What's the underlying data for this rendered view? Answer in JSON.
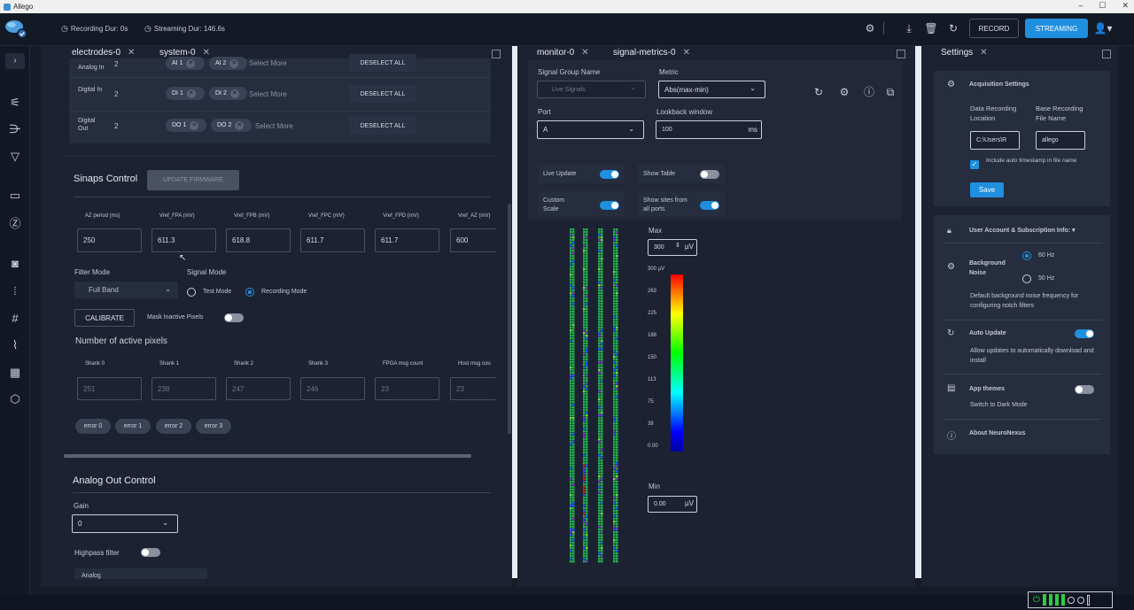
{
  "window": {
    "title": "Allego",
    "controls": [
      "–",
      "☐",
      "✕"
    ]
  },
  "topbar": {
    "recording_dur": "Recording Dur: 0s",
    "streaming_dur": "Streaming Dur: 146.6s",
    "record_label": "RECORD",
    "streaming_label": "STREAMING"
  },
  "left_panel": {
    "tabs": [
      "electrodes-0",
      "system-0"
    ],
    "io_rows": [
      {
        "label": "Analog In",
        "count": "2",
        "chips": [
          "AI 1",
          "AI 2"
        ],
        "select_more": "Select More",
        "deselect": "DESELECT ALL"
      },
      {
        "label": "Digital In",
        "count": "2",
        "chips": [
          "DI 1",
          "DI 2"
        ],
        "select_more": "Select More",
        "deselect": "DESELECT ALL"
      },
      {
        "label": "Digital Out",
        "count": "2",
        "chips": [
          "DO 1",
          "DO 2"
        ],
        "select_more": "Select More",
        "deselect": "DESELECT ALL"
      }
    ],
    "sinaps": {
      "title": "Sinaps Control",
      "update_firmware": "UPDATE FIRMWARE",
      "fields": [
        {
          "label": "AZ period (ms)",
          "value": "250"
        },
        {
          "label": "Vref_FPA (mV)",
          "value": "611.3"
        },
        {
          "label": "Vref_FPB (mV)",
          "value": "618.8"
        },
        {
          "label": "Vref_FPC (mV)",
          "value": "611.7"
        },
        {
          "label": "Vref_FPD (mV)",
          "value": "611.7"
        },
        {
          "label": "Vref_AZ (mV)",
          "value": "600"
        }
      ],
      "filter_mode_label": "Filter Mode",
      "filter_mode_value": "Full Band",
      "signal_mode_label": "Signal Mode",
      "test_mode": "Test Mode",
      "recording_mode": "Recording Mode",
      "calibrate": "CALIBRATE",
      "mask_inactive": "Mask Inactive Pixels",
      "active_pixels_title": "Number of active pixels",
      "pixels": [
        {
          "label": "Shank 0",
          "value": "251"
        },
        {
          "label": "Shank 1",
          "value": "238"
        },
        {
          "label": "Shank 2",
          "value": "247"
        },
        {
          "label": "Shank 3",
          "value": "246"
        },
        {
          "label": "FPGA msg count",
          "value": "23"
        },
        {
          "label": "Host msg cou",
          "value": "23"
        }
      ],
      "errors": [
        "error 0",
        "error 1",
        "error 2",
        "error 3"
      ]
    },
    "analog_out": {
      "title": "Analog Out Control",
      "gain_label": "Gain",
      "gain_value": "0",
      "highpass": "Highpass filter",
      "analog": "Analog"
    }
  },
  "monitor": {
    "tabs": [
      "monitor-0",
      "signal-metrics-0"
    ],
    "signal_group_label": "Signal Group Name",
    "signal_group_value": "Live Signals",
    "metric_label": "Metric",
    "metric_value": "Abs(max-min)",
    "port_label": "Port",
    "port_value": "A",
    "lookback_label": "Lookback window",
    "lookback_value": "100",
    "lookback_unit": "ms",
    "live_update": "Live Update",
    "show_table": "Show Table",
    "custom_scale": "Custom Scale",
    "show_sites": "Show sites from all ports",
    "max_label": "Max",
    "max_value": "300",
    "max_unit": "µV",
    "min_label": "Min",
    "min_value": "0.00",
    "min_unit": "µV",
    "scale_ticks": [
      "300 µV",
      "263",
      "225",
      "188",
      "150",
      "113",
      "75",
      "38",
      "0.00"
    ]
  },
  "settings": {
    "tab": "Settings",
    "acq_title": "Acquisition Settings",
    "data_loc_label": "Data Recording Location",
    "data_loc_value": "C:\\Users\\R",
    "base_name_label": "Base Recording File Name",
    "base_name_value": "allego",
    "timestamp_label": "Include auto timestamp in file name",
    "save": "Save",
    "user_account": "User Account & Subscription Info:",
    "bg_noise": "Background Noise",
    "hz60": "60 Hz",
    "hz50": "50 Hz",
    "bg_noise_desc": "Default background noise frequency for configuring notch filters",
    "auto_update": "Auto Update",
    "auto_update_desc": "Allow updates to automatically download and install",
    "app_themes": "App themes",
    "app_themes_desc": "Switch to Dark Mode",
    "about": "About NeuroNexus"
  },
  "colors": {
    "accent": "#1f8fe0",
    "bg": "#161b28",
    "panel": "#1c2232",
    "card": "#262d3f"
  }
}
